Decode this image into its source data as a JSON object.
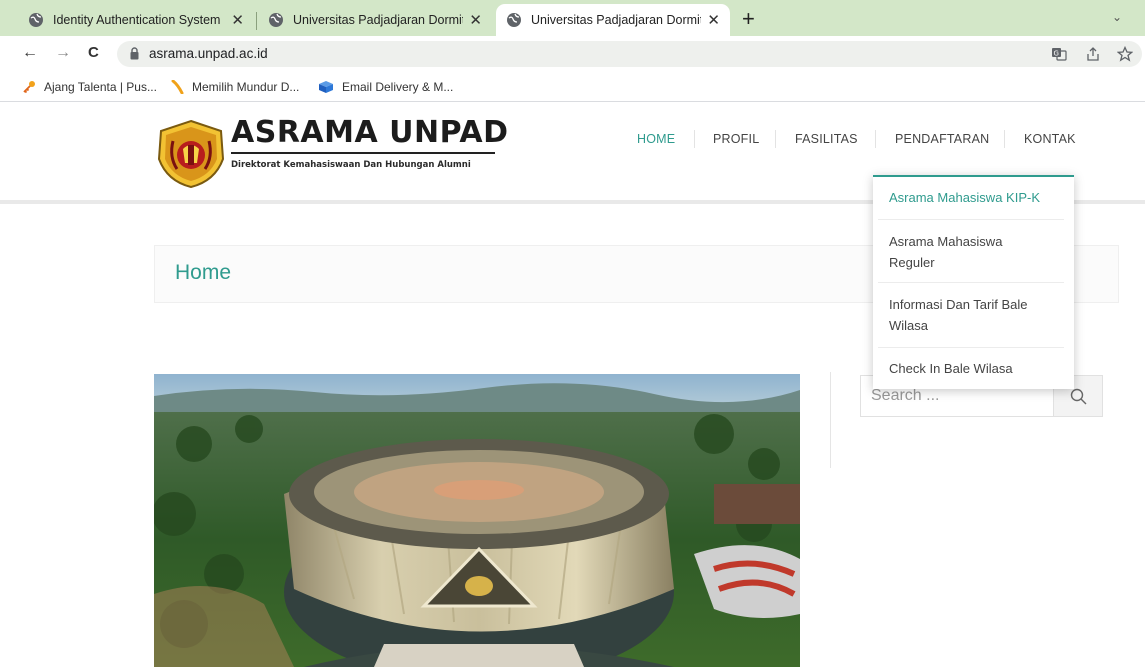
{
  "browser": {
    "tabs": [
      {
        "title": "Identity Authentication System",
        "active": false
      },
      {
        "title": "Universitas Padjadjaran Dormitor",
        "active": false
      },
      {
        "title": "Universitas Padjadjaran Dormitor",
        "active": true
      }
    ],
    "close_glyph": "✕",
    "new_tab_glyph": "+",
    "tab_menu_glyph": "⌄",
    "nav": {
      "back": "←",
      "forward": "→",
      "reload": "C"
    },
    "url": "asrama.unpad.ac.id",
    "bookmarks": [
      {
        "label": "Ajang Talenta | Pus...",
        "icon": "key-icon"
      },
      {
        "label": "Memilih Mundur D...",
        "icon": "feather-icon"
      },
      {
        "label": "Email Delivery & M...",
        "icon": "cube-icon"
      }
    ]
  },
  "site": {
    "brand": {
      "title": "ASRAMA UNPAD",
      "subtitle": "Direktorat Kemahasiswaan Dan Hubungan Alumni"
    },
    "menu": [
      {
        "label": "HOME",
        "active": true
      },
      {
        "label": "PROFIL",
        "active": false
      },
      {
        "label": "FASILITAS",
        "active": false
      },
      {
        "label": "PENDAFTARAN",
        "active": false
      },
      {
        "label": "KONTAK",
        "active": false
      }
    ],
    "dropdown": [
      {
        "label": "Asrama Mahasiswa KIP-K",
        "active": true
      },
      {
        "label": "Asrama Mahasiswa Reguler",
        "active": false
      },
      {
        "label": "Informasi Dan Tarif Bale Wilasa",
        "active": false
      },
      {
        "label": "Check In Bale Wilasa",
        "active": false
      }
    ],
    "page_title": "Home",
    "search": {
      "placeholder": "Search ..."
    }
  },
  "colors": {
    "accent": "#2f9b8e",
    "tabstrip": "#d3e7c8"
  }
}
